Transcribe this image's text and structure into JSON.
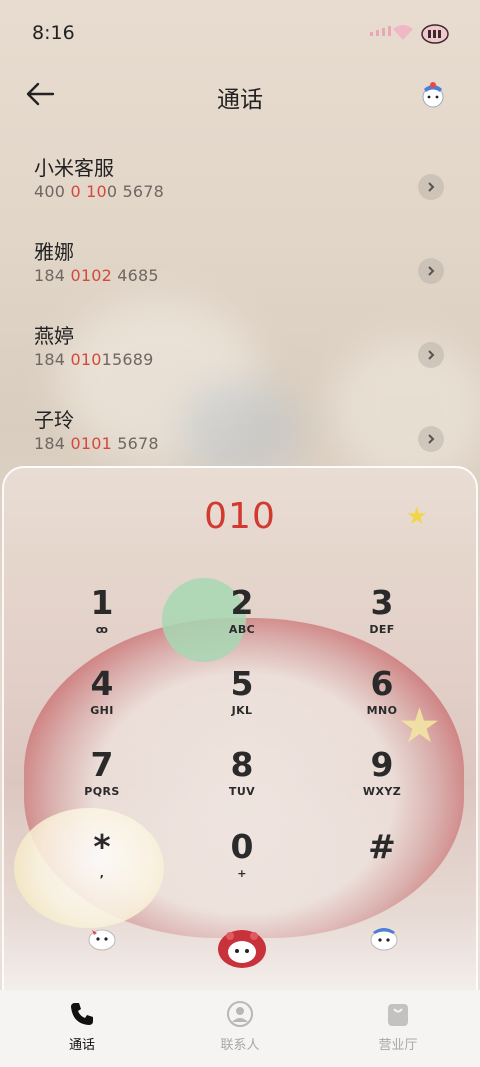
{
  "status_bar": {
    "time": "8:16"
  },
  "header": {
    "title": "通话",
    "back_icon": "arrow-left-icon"
  },
  "results": [
    {
      "name": "小米客服",
      "num_pre": "400 ",
      "num_hl": "0 10",
      "num_post": "0 5678"
    },
    {
      "name": "雅娜",
      "num_pre": "184 ",
      "num_hl": "0102",
      "num_post": " 4685"
    },
    {
      "name": "燕婷",
      "num_pre": "184 ",
      "num_hl": "010",
      "num_post": "15689"
    },
    {
      "name": "子玲",
      "num_pre": "184 ",
      "num_hl": "0101",
      "num_post": " 5678"
    }
  ],
  "dialer": {
    "number": "010",
    "keys": [
      {
        "digit": "1",
        "letters": "ꝏ"
      },
      {
        "digit": "2",
        "letters": "ABC"
      },
      {
        "digit": "3",
        "letters": "DEF"
      },
      {
        "digit": "4",
        "letters": "GHI"
      },
      {
        "digit": "5",
        "letters": "JKL"
      },
      {
        "digit": "6",
        "letters": "MNO"
      },
      {
        "digit": "7",
        "letters": "PQRS"
      },
      {
        "digit": "8",
        "letters": "TUV"
      },
      {
        "digit": "9",
        "letters": "WXYZ"
      },
      {
        "digit": "*",
        "letters": ","
      },
      {
        "digit": "0",
        "letters": "+"
      },
      {
        "digit": "#",
        "letters": ""
      }
    ]
  },
  "tabs": [
    {
      "label": "通话",
      "icon": "phone-icon",
      "active": true
    },
    {
      "label": "联系人",
      "icon": "person-icon",
      "active": false
    },
    {
      "label": "营业厅",
      "icon": "shopping-bag-icon",
      "active": false
    }
  ],
  "colors": {
    "accent": "#d2392f",
    "highlight": "#d24a3c",
    "text": "#222222"
  }
}
